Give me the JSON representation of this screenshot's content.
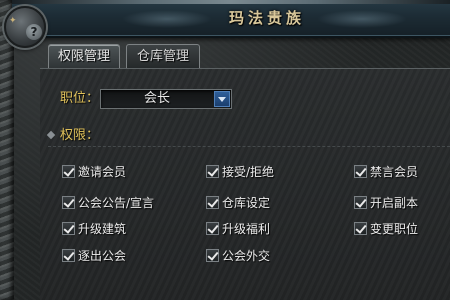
{
  "window": {
    "title": "玛法贵族"
  },
  "tabs": [
    {
      "label": "权限管理",
      "active": true
    },
    {
      "label": "仓库管理",
      "active": false
    }
  ],
  "position": {
    "label": "职位：",
    "selected": "会长"
  },
  "permissions": {
    "header": "权限：",
    "items": [
      {
        "label": "邀请会员",
        "checked": true
      },
      {
        "label": "接受/拒绝",
        "checked": true
      },
      {
        "label": "禁言会员",
        "checked": true
      },
      {
        "label": "公会公告/宣言",
        "checked": true
      },
      {
        "label": "仓库设定",
        "checked": true
      },
      {
        "label": "开启副本",
        "checked": true
      },
      {
        "label": "升级建筑",
        "checked": true
      },
      {
        "label": "升级福利",
        "checked": true
      },
      {
        "label": "变更职位",
        "checked": true
      },
      {
        "label": "逐出公会",
        "checked": true
      },
      {
        "label": "公会外交",
        "checked": true
      }
    ]
  },
  "colors": {
    "label_gold": "#e0c15a",
    "title_gold": "#d8c79a",
    "dropdown_blue": "#2f5f9a"
  },
  "icons": [
    "help-icon",
    "dropdown-arrow-icon",
    "checkmark-icon"
  ]
}
